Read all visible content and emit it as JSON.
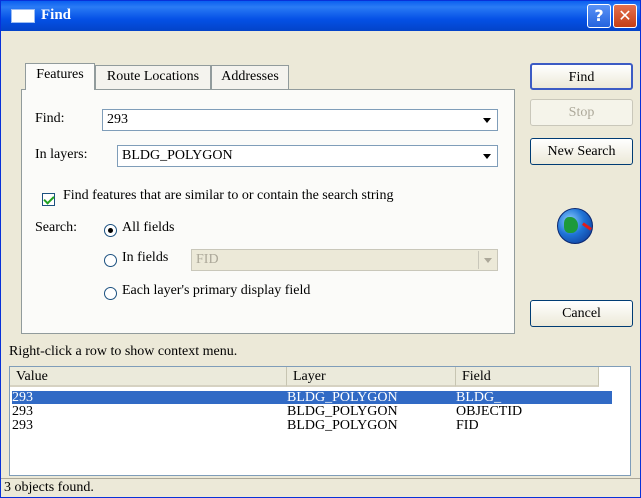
{
  "window": {
    "title": "Find",
    "help_glyph": "?",
    "close_glyph": "✕"
  },
  "tabs": [
    {
      "label": "Features",
      "active": true
    },
    {
      "label": "Route Locations",
      "active": false
    },
    {
      "label": "Addresses",
      "active": false
    }
  ],
  "form": {
    "find_label": "Find:",
    "find_value": "293",
    "layers_label": "In layers:",
    "layers_value": "BLDG_POLYGON",
    "similar_checkbox_label": "Find features that are similar to or contain the search string",
    "similar_checked": true,
    "search_label": "Search:",
    "radio_all_fields": "All fields",
    "radio_in_fields": "In fields",
    "in_fields_value": "FID",
    "radio_primary_display": "Each layer's primary display field",
    "selected_radio": "all_fields"
  },
  "buttons": {
    "find": "Find",
    "stop": "Stop",
    "new_search": "New Search",
    "cancel": "Cancel"
  },
  "results": {
    "hint": "Right-click a row to show context menu.",
    "columns": [
      "Value",
      "Layer",
      "Field"
    ],
    "rows": [
      {
        "value": "293",
        "layer": "BLDG_POLYGON",
        "field": "BLDG_",
        "selected": true
      },
      {
        "value": "293",
        "layer": "BLDG_POLYGON",
        "field": "OBJECTID",
        "selected": false
      },
      {
        "value": "293",
        "layer": "BLDG_POLYGON",
        "field": "FID",
        "selected": false
      }
    ],
    "status": "3 objects found."
  },
  "colors": {
    "titlebar": "#0551e6",
    "selection": "#316ac5",
    "face": "#ece9d8"
  }
}
